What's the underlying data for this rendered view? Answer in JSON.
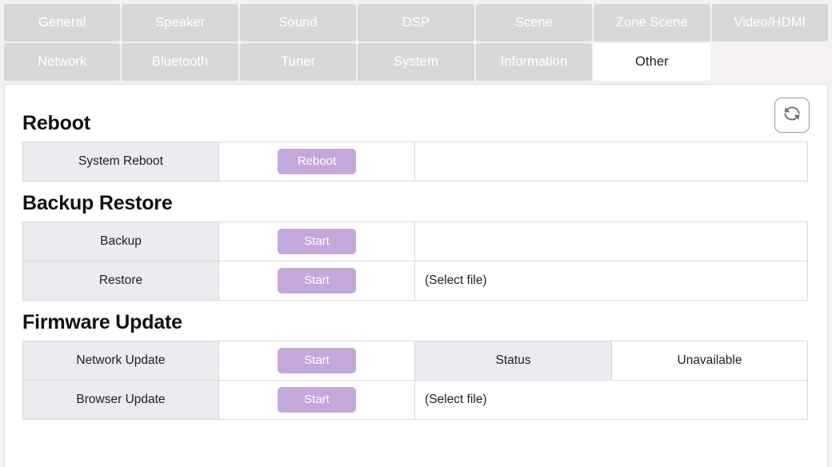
{
  "tabs": {
    "row1": [
      {
        "label": "General",
        "active": false
      },
      {
        "label": "Speaker",
        "active": false
      },
      {
        "label": "Sound",
        "active": false
      },
      {
        "label": "DSP",
        "active": false
      },
      {
        "label": "Scene",
        "active": false
      },
      {
        "label": "Zone Scene",
        "active": false
      },
      {
        "label": "Video/HDMI",
        "active": false
      }
    ],
    "row2": [
      {
        "label": "Network",
        "active": false
      },
      {
        "label": "Bluetooth",
        "active": false
      },
      {
        "label": "Tuner",
        "active": false
      },
      {
        "label": "System",
        "active": false
      },
      {
        "label": "Information",
        "active": false
      },
      {
        "label": "Other",
        "active": true
      },
      {
        "label": "",
        "active": false
      }
    ]
  },
  "toolbar": {
    "refresh_icon": "refresh-icon"
  },
  "sections": {
    "reboot": {
      "title": "Reboot",
      "rows": [
        {
          "label": "System Reboot",
          "button": "Reboot"
        }
      ]
    },
    "backup_restore": {
      "title": "Backup Restore",
      "rows": [
        {
          "label": "Backup",
          "button": "Start",
          "file": ""
        },
        {
          "label": "Restore",
          "button": "Start",
          "file": "(Select file)"
        }
      ]
    },
    "firmware_update": {
      "title": "Firmware Update",
      "rows": [
        {
          "label": "Network Update",
          "button": "Start",
          "status_label": "Status",
          "status_value": "Unavailable"
        },
        {
          "label": "Browser Update",
          "button": "Start",
          "file": "(Select file)"
        }
      ]
    }
  },
  "colors": {
    "accent": "#c4a8db",
    "tab_inactive": "#d8d8d8",
    "tab_active": "#ffffff",
    "page_bg": "#f4f0f4",
    "label_cell_bg": "#ebebf0"
  }
}
